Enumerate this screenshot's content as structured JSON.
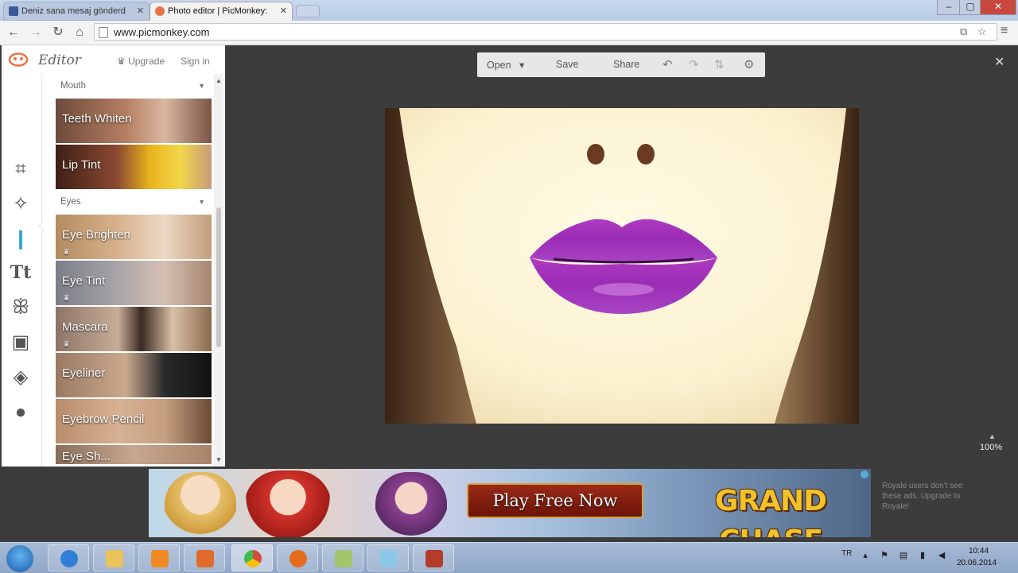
{
  "browser": {
    "tabs": [
      {
        "title": "Deniz sana mesaj gönderd",
        "active": false
      },
      {
        "title": "Photo editor | PicMonkey:",
        "active": true
      }
    ],
    "url": "www.picmonkey.com"
  },
  "app": {
    "logo_text": "Editor",
    "upgrade": "Upgrade",
    "sign_in": "Sign in",
    "tools": [
      "crop-icon",
      "magic-wand-icon",
      "lipstick-icon",
      "text-icon",
      "butterfly-icon",
      "frame-icon",
      "texture-icon",
      "apple-icon"
    ],
    "sections": [
      {
        "label": "Mouth",
        "effects": [
          "Teeth Whiten",
          "Lip Tint"
        ]
      },
      {
        "label": "Eyes",
        "effects": [
          "Eye Brighten",
          "Eye Tint",
          "Mascara",
          "Eyeliner",
          "Eyebrow Pencil",
          "Eye Sh..."
        ]
      }
    ],
    "toolbar": {
      "open": "Open",
      "save": "Save",
      "share": "Share"
    },
    "zoom": "100%"
  },
  "ad": {
    "cta": "Play Free Now",
    "brand": "GRAND CHASE",
    "royale_note": "Royale users don't see these ads. Upgrade to Royale!"
  },
  "taskbar": {
    "lang": "TR",
    "time": "10:44",
    "date": "20.06.2014"
  }
}
